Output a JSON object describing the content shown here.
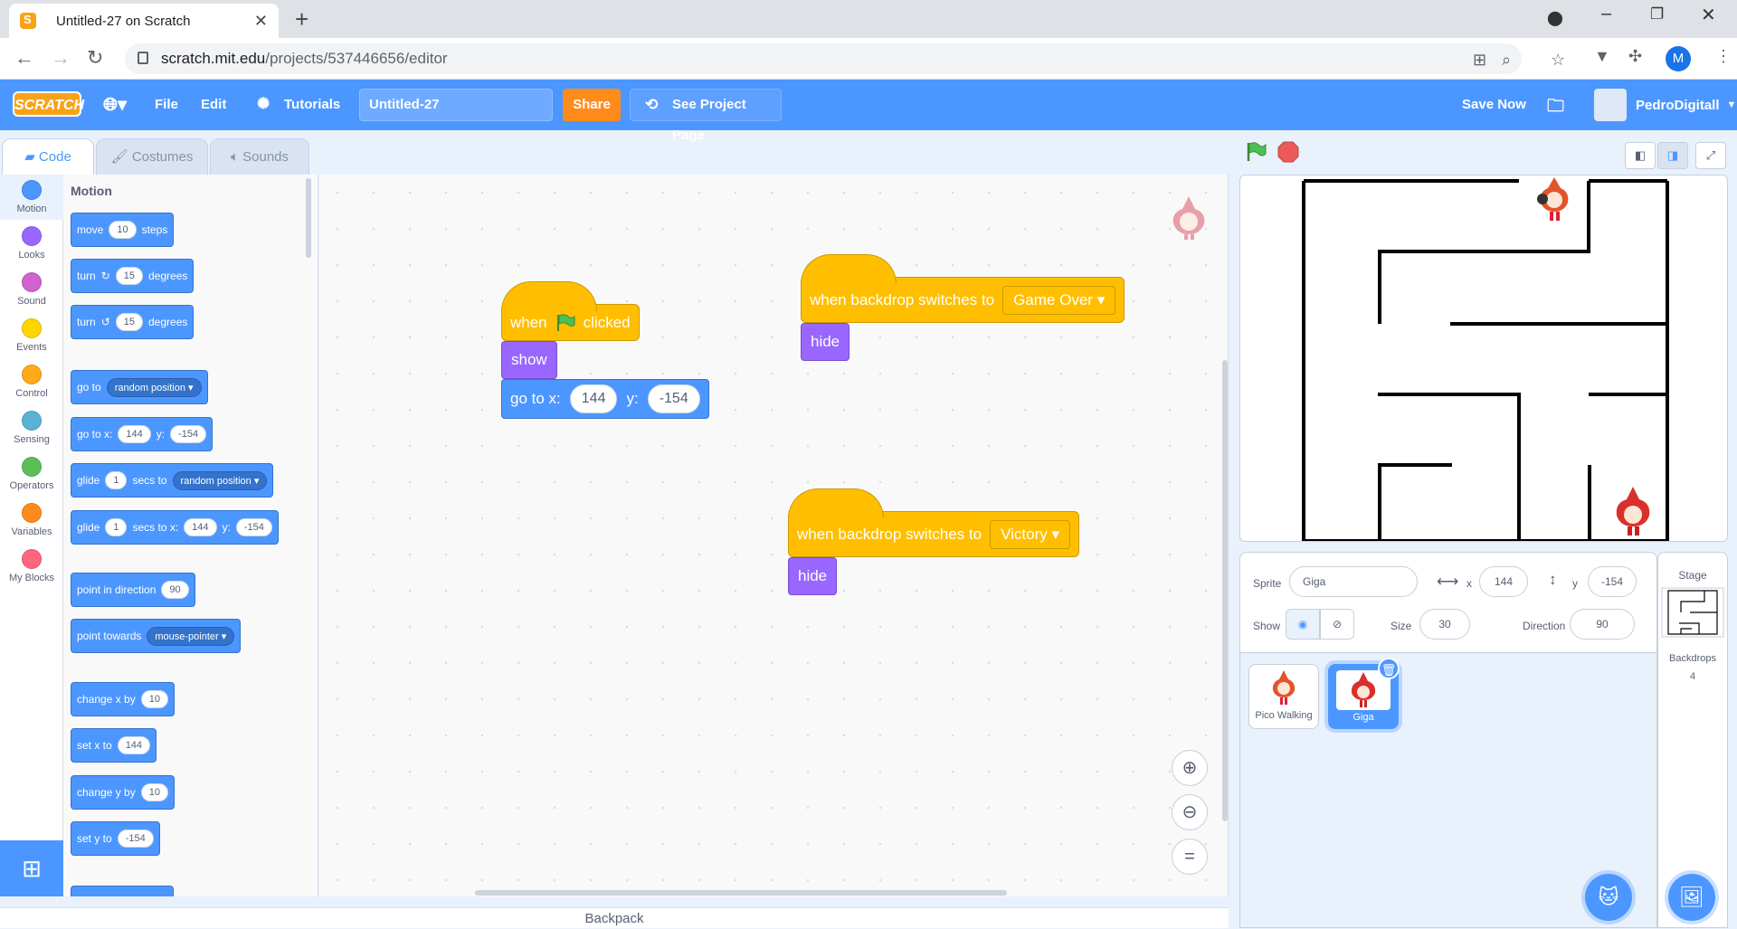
{
  "browser": {
    "tab_title": "Untitled-27 on Scratch",
    "url_host": "scratch.mit.edu",
    "url_path": "/projects/537446656/editor",
    "profile_initial": "M"
  },
  "menubar": {
    "logo": "SCRATCH",
    "file": "File",
    "edit": "Edit",
    "tutorials": "Tutorials",
    "project_title": "Untitled-27",
    "share": "Share",
    "see_project_page": "See Project Page",
    "save_now": "Save Now",
    "username": "PedroDigitall"
  },
  "tabs": {
    "code": "Code",
    "costumes": "Costumes",
    "sounds": "Sounds"
  },
  "categories": [
    {
      "label": "Motion",
      "color": "#4c97ff"
    },
    {
      "label": "Looks",
      "color": "#9966ff"
    },
    {
      "label": "Sound",
      "color": "#cf63cf"
    },
    {
      "label": "Events",
      "color": "#ffd500"
    },
    {
      "label": "Control",
      "color": "#ffab19"
    },
    {
      "label": "Sensing",
      "color": "#5cb1d6"
    },
    {
      "label": "Operators",
      "color": "#59c059"
    },
    {
      "label": "Variables",
      "color": "#ff8c1a"
    },
    {
      "label": "My Blocks",
      "color": "#ff6680"
    }
  ],
  "palette": {
    "heading": "Motion",
    "move": {
      "a": "move",
      "v": "10",
      "b": "steps"
    },
    "turn_right": {
      "a": "turn",
      "icon": "rotate-right-icon",
      "v": "15",
      "b": "degrees"
    },
    "turn_left": {
      "a": "turn",
      "icon": "rotate-left-icon",
      "v": "15",
      "b": "degrees"
    },
    "goto": {
      "a": "go to",
      "dd": "random position"
    },
    "gotoxy": {
      "a": "go to x:",
      "x": "144",
      "b": "y:",
      "y": "-154"
    },
    "glide_to": {
      "a": "glide",
      "v": "1",
      "b": "secs to",
      "dd": "random position"
    },
    "glide_xy": {
      "a": "glide",
      "v": "1",
      "b": "secs to x:",
      "x": "144",
      "c": "y:",
      "y": "-154"
    },
    "point_dir": {
      "a": "point in direction",
      "v": "90"
    },
    "point_towards": {
      "a": "point towards",
      "dd": "mouse-pointer"
    },
    "change_x": {
      "a": "change x by",
      "v": "10"
    },
    "set_x": {
      "a": "set x to",
      "v": "144"
    },
    "change_y": {
      "a": "change y by",
      "v": "10"
    },
    "set_y": {
      "a": "set y to",
      "v": "-154"
    }
  },
  "script1": {
    "when": "when",
    "clicked": "clicked",
    "show": "show",
    "goto": "go to x:",
    "x": "144",
    "y_label": "y:",
    "y": "-154"
  },
  "script2": {
    "label": "when backdrop switches to",
    "backdrop": "Game Over",
    "hide": "hide"
  },
  "script3": {
    "label": "when backdrop switches to",
    "backdrop": "Victory",
    "hide": "hide"
  },
  "backpack": "Backpack",
  "sprite_info": {
    "sprite_label": "Sprite",
    "sprite_name": "Giga",
    "x_label": "x",
    "x": "144",
    "y_label": "y",
    "y": "-154",
    "show_label": "Show",
    "size_label": "Size",
    "size": "30",
    "direction_label": "Direction",
    "direction": "90"
  },
  "sprites": [
    {
      "name": "Pico Walking",
      "selected": false
    },
    {
      "name": "Giga",
      "selected": true
    }
  ],
  "stage_panel": {
    "title": "Stage",
    "backdrops_label": "Backdrops",
    "backdrops_count": "4"
  }
}
